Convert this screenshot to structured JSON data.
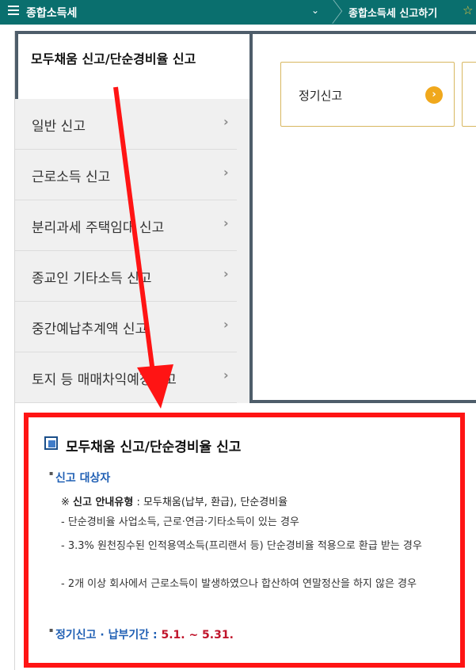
{
  "topbar": {
    "section": "종합소득세",
    "crumb": "종합소득세 신고하기",
    "menu_icon": "hamburger-icon",
    "chevron_icon": "chevron-down-icon",
    "star_icon": "star-icon"
  },
  "active_menu": {
    "label": "모두채움 신고/단순경비율 신고"
  },
  "submenu": {
    "items": [
      {
        "label": "일반 신고"
      },
      {
        "label": "근로소득 신고"
      },
      {
        "label": "분리과세 주택임대 신고"
      },
      {
        "label": "종교인 기타소득 신고"
      },
      {
        "label": "중간예납추계액 신고"
      },
      {
        "label": "토지 등 매매차익예정신고"
      }
    ],
    "arrow": "›"
  },
  "tiles": [
    {
      "label": "정기신고",
      "go": "›"
    }
  ],
  "info": {
    "title": "모두채움 신고/단순경비율 신고",
    "target_heading": "신고 대상자",
    "note_prefix": "※ ",
    "note_bold": "신고 안내유형",
    "note_rest": " : 모두채움(납부, 환급), 단순경비율",
    "lines": [
      "- 단순경비율 사업소득, 근로·연금·기타소득이 있는 경우",
      "- 3.3% 원천징수된 인적용역소득(프리랜서 등) 단순경비율 적용으로 환급 받는 경우",
      "- 2개 이상 회사에서 근로소득이 발생하였으나 합산하여 연말정산을 하지 않은 경우"
    ],
    "period_label": "정기신고 · 납부기간 : ",
    "period_dates": "5.1. ~ 5.31."
  },
  "colors": {
    "topbar": "#0a6f6e",
    "highlight": "#ff1414",
    "accent": "#f0a81c",
    "heading_blue": "#1f5fb4"
  }
}
